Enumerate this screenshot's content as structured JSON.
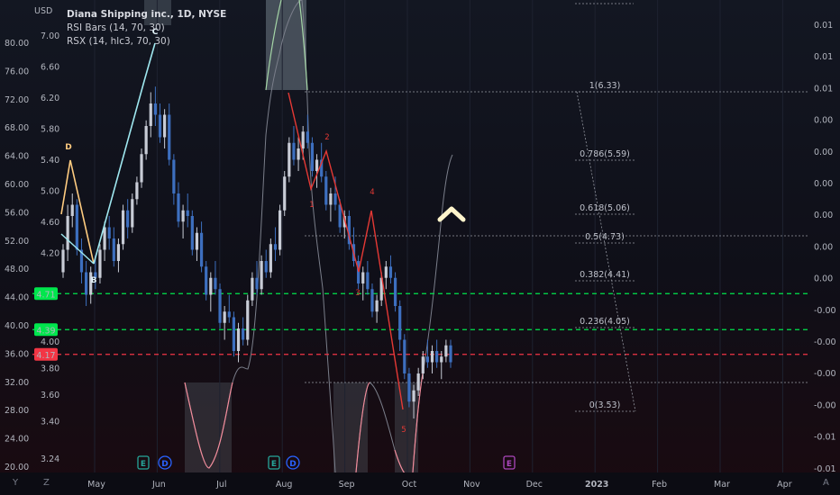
{
  "header": {
    "currency": "USD",
    "legend": [
      "Diana Shipping inc., 1D, NYSE",
      "RSI Bars (14, 70, 30)",
      "RSX (14, hlc3, 70, 30)"
    ]
  },
  "corners": {
    "bottom_left": "Y",
    "zoom": "Z",
    "auto": "A"
  },
  "colors": {
    "up_candle": "#c8ccd6",
    "down_candle": "#3d6fbf",
    "harmonic_xab": "#ffcc80",
    "harmonic_bc": "#9fe8f0",
    "wave_red": "#e53935",
    "rsx_line": "#8a8e99",
    "hline_green": "#00e64d",
    "hline_red": "#f23645",
    "fib_line": "#9598a1",
    "arrow": "#fff5cc",
    "earnings": "#26a69a",
    "dividend": "#2962ff",
    "event_purple": "#ab47bc"
  },
  "chart_data": {
    "type": "candlestick",
    "title": "Diana Shipping inc., 1D, NYSE",
    "price_scale_left": [
      "7.00",
      "6.60",
      "6.20",
      "5.80",
      "5.40",
      "5.00",
      "4.60",
      "4.20",
      "4.00",
      "3.80",
      "3.60",
      "3.40",
      "3.24"
    ],
    "outer_scale_left": [
      "80.00",
      "76.00",
      "72.00",
      "68.00",
      "64.00",
      "60.00",
      "56.00",
      "52.00",
      "48.00",
      "44.00",
      "40.00",
      "36.00",
      "32.00",
      "28.00",
      "24.00",
      "20.00"
    ],
    "right_scale": [
      "0.01",
      "0.01",
      "0.01",
      "0.00",
      "0.00",
      "0.00",
      "0.00",
      "0.00",
      "0.00",
      "-0.00",
      "-0.00",
      "-0.00",
      "-0.00",
      "-0.01",
      "-0.01",
      "-0.01"
    ],
    "x_labels": [
      "May",
      "Jun",
      "Jul",
      "Aug",
      "Sep",
      "Oct",
      "Nov",
      "Dec",
      "2023",
      "Feb",
      "Mar",
      "Apr"
    ],
    "ylim": [
      3.2,
      7.3
    ],
    "ohlc": [
      [
        4.9,
        5.15,
        4.85,
        5.1
      ],
      [
        5.1,
        5.5,
        5.0,
        5.4
      ],
      [
        5.4,
        5.6,
        5.3,
        5.5
      ],
      [
        5.5,
        5.55,
        5.05,
        5.1
      ],
      [
        5.1,
        5.2,
        4.8,
        4.9
      ],
      [
        4.9,
        5.0,
        4.6,
        4.7
      ],
      [
        4.7,
        4.95,
        4.62,
        4.9
      ],
      [
        4.9,
        5.05,
        4.75,
        4.85
      ],
      [
        4.85,
        5.15,
        4.8,
        5.1
      ],
      [
        5.1,
        5.35,
        5.0,
        5.3
      ],
      [
        5.3,
        5.4,
        5.1,
        5.2
      ],
      [
        5.2,
        5.3,
        4.95,
        5.0
      ],
      [
        5.0,
        5.2,
        4.9,
        5.15
      ],
      [
        5.15,
        5.5,
        5.1,
        5.45
      ],
      [
        5.45,
        5.55,
        5.2,
        5.3
      ],
      [
        5.3,
        5.6,
        5.25,
        5.55
      ],
      [
        5.55,
        5.75,
        5.5,
        5.7
      ],
      [
        5.7,
        6.0,
        5.65,
        5.95
      ],
      [
        5.95,
        6.25,
        5.9,
        6.2
      ],
      [
        6.2,
        6.5,
        6.1,
        6.4
      ],
      [
        6.4,
        6.55,
        6.2,
        6.3
      ],
      [
        6.3,
        6.4,
        6.05,
        6.1
      ],
      [
        6.1,
        6.35,
        6.0,
        6.3
      ],
      [
        6.3,
        6.4,
        5.85,
        5.9
      ],
      [
        5.9,
        5.95,
        5.5,
        5.6
      ],
      [
        5.6,
        5.7,
        5.3,
        5.35
      ],
      [
        5.35,
        5.5,
        5.2,
        5.45
      ],
      [
        5.45,
        5.6,
        5.3,
        5.4
      ],
      [
        5.4,
        5.45,
        5.05,
        5.1
      ],
      [
        5.1,
        5.3,
        5.0,
        5.25
      ],
      [
        5.25,
        5.35,
        4.9,
        4.95
      ],
      [
        4.95,
        5.0,
        4.65,
        4.7
      ],
      [
        4.7,
        4.9,
        4.55,
        4.85
      ],
      [
        4.85,
        5.0,
        4.7,
        4.75
      ],
      [
        4.75,
        4.8,
        4.4,
        4.45
      ],
      [
        4.45,
        4.6,
        4.3,
        4.55
      ],
      [
        4.55,
        4.7,
        4.45,
        4.5
      ],
      [
        4.5,
        4.55,
        4.15,
        4.2
      ],
      [
        4.2,
        4.45,
        4.1,
        4.4
      ],
      [
        4.4,
        4.5,
        4.25,
        4.3
      ],
      [
        4.3,
        4.7,
        4.25,
        4.65
      ],
      [
        4.65,
        4.9,
        4.6,
        4.85
      ],
      [
        4.85,
        5.0,
        4.7,
        4.75
      ],
      [
        4.75,
        5.05,
        4.7,
        5.0
      ],
      [
        5.0,
        5.1,
        4.85,
        4.9
      ],
      [
        4.9,
        5.2,
        4.85,
        5.15
      ],
      [
        5.15,
        5.3,
        5.0,
        5.1
      ],
      [
        5.1,
        5.5,
        5.05,
        5.45
      ],
      [
        5.45,
        5.8,
        5.4,
        5.75
      ],
      [
        5.75,
        6.1,
        5.7,
        6.05
      ],
      [
        6.05,
        6.2,
        5.85,
        5.9
      ],
      [
        5.9,
        6.1,
        5.8,
        6.0
      ],
      [
        6.0,
        6.2,
        5.9,
        6.15
      ],
      [
        6.15,
        6.3,
        6.0,
        6.05
      ],
      [
        6.05,
        6.1,
        5.75,
        5.8
      ],
      [
        5.8,
        5.95,
        5.65,
        5.9
      ],
      [
        5.9,
        6.05,
        5.7,
        5.75
      ],
      [
        5.75,
        5.8,
        5.45,
        5.5
      ],
      [
        5.5,
        5.65,
        5.35,
        5.6
      ],
      [
        5.6,
        5.75,
        5.45,
        5.5
      ],
      [
        5.5,
        5.55,
        5.25,
        5.3
      ],
      [
        5.3,
        5.45,
        5.2,
        5.4
      ],
      [
        5.4,
        5.45,
        5.1,
        5.15
      ],
      [
        5.15,
        5.3,
        4.95,
        5.0
      ],
      [
        5.0,
        5.05,
        4.75,
        4.8
      ],
      [
        4.8,
        4.95,
        4.65,
        4.9
      ],
      [
        4.9,
        5.0,
        4.7,
        4.75
      ],
      [
        4.75,
        4.8,
        4.5,
        4.55
      ],
      [
        4.55,
        4.7,
        4.45,
        4.65
      ],
      [
        4.65,
        4.9,
        4.6,
        4.85
      ],
      [
        4.85,
        5.0,
        4.75,
        4.95
      ],
      [
        4.95,
        5.05,
        4.8,
        4.85
      ],
      [
        4.85,
        4.9,
        4.55,
        4.6
      ],
      [
        4.6,
        4.65,
        4.2,
        4.3
      ],
      [
        4.3,
        4.35,
        3.95,
        4.0
      ],
      [
        4.0,
        4.05,
        3.7,
        3.75
      ],
      [
        3.75,
        3.9,
        3.6,
        3.85
      ],
      [
        3.85,
        4.05,
        3.8,
        4.0
      ],
      [
        4.0,
        4.2,
        3.95,
        4.15
      ],
      [
        4.15,
        4.3,
        4.05,
        4.1
      ],
      [
        4.1,
        4.25,
        4.0,
        4.2
      ],
      [
        4.2,
        4.3,
        4.05,
        4.1
      ],
      [
        4.1,
        4.2,
        3.95,
        4.15
      ],
      [
        4.15,
        4.3,
        4.1,
        4.25
      ],
      [
        4.25,
        4.3,
        4.05,
        4.1
      ]
    ],
    "horizontal_levels": [
      {
        "label": "4.71",
        "value": 4.71,
        "color": "#00e64d"
      },
      {
        "label": "4.39",
        "value": 4.39,
        "color": "#00e64d"
      },
      {
        "label": "4.17",
        "value": 4.17,
        "color": "#f23645"
      }
    ],
    "fib_levels": [
      {
        "label": "1(6.33)",
        "value": 6.33
      },
      {
        "label": "0.786(5.59)",
        "value": 5.59
      },
      {
        "label": "0.618(5.06)",
        "value": 5.06
      },
      {
        "label": "0.5(4.73)",
        "value": 4.73
      },
      {
        "label": "0.382(4.41)",
        "value": 4.41
      },
      {
        "label": "0.236(4.05)",
        "value": 4.05
      },
      {
        "label": "0(3.53)",
        "value": 3.53
      }
    ],
    "harmonic_labels": [
      "D",
      "B",
      "C"
    ],
    "wave_labels": [
      "1",
      "2",
      "3",
      "4",
      "5"
    ],
    "event_markers": [
      "E",
      "D",
      "E",
      "D",
      "E"
    ]
  }
}
